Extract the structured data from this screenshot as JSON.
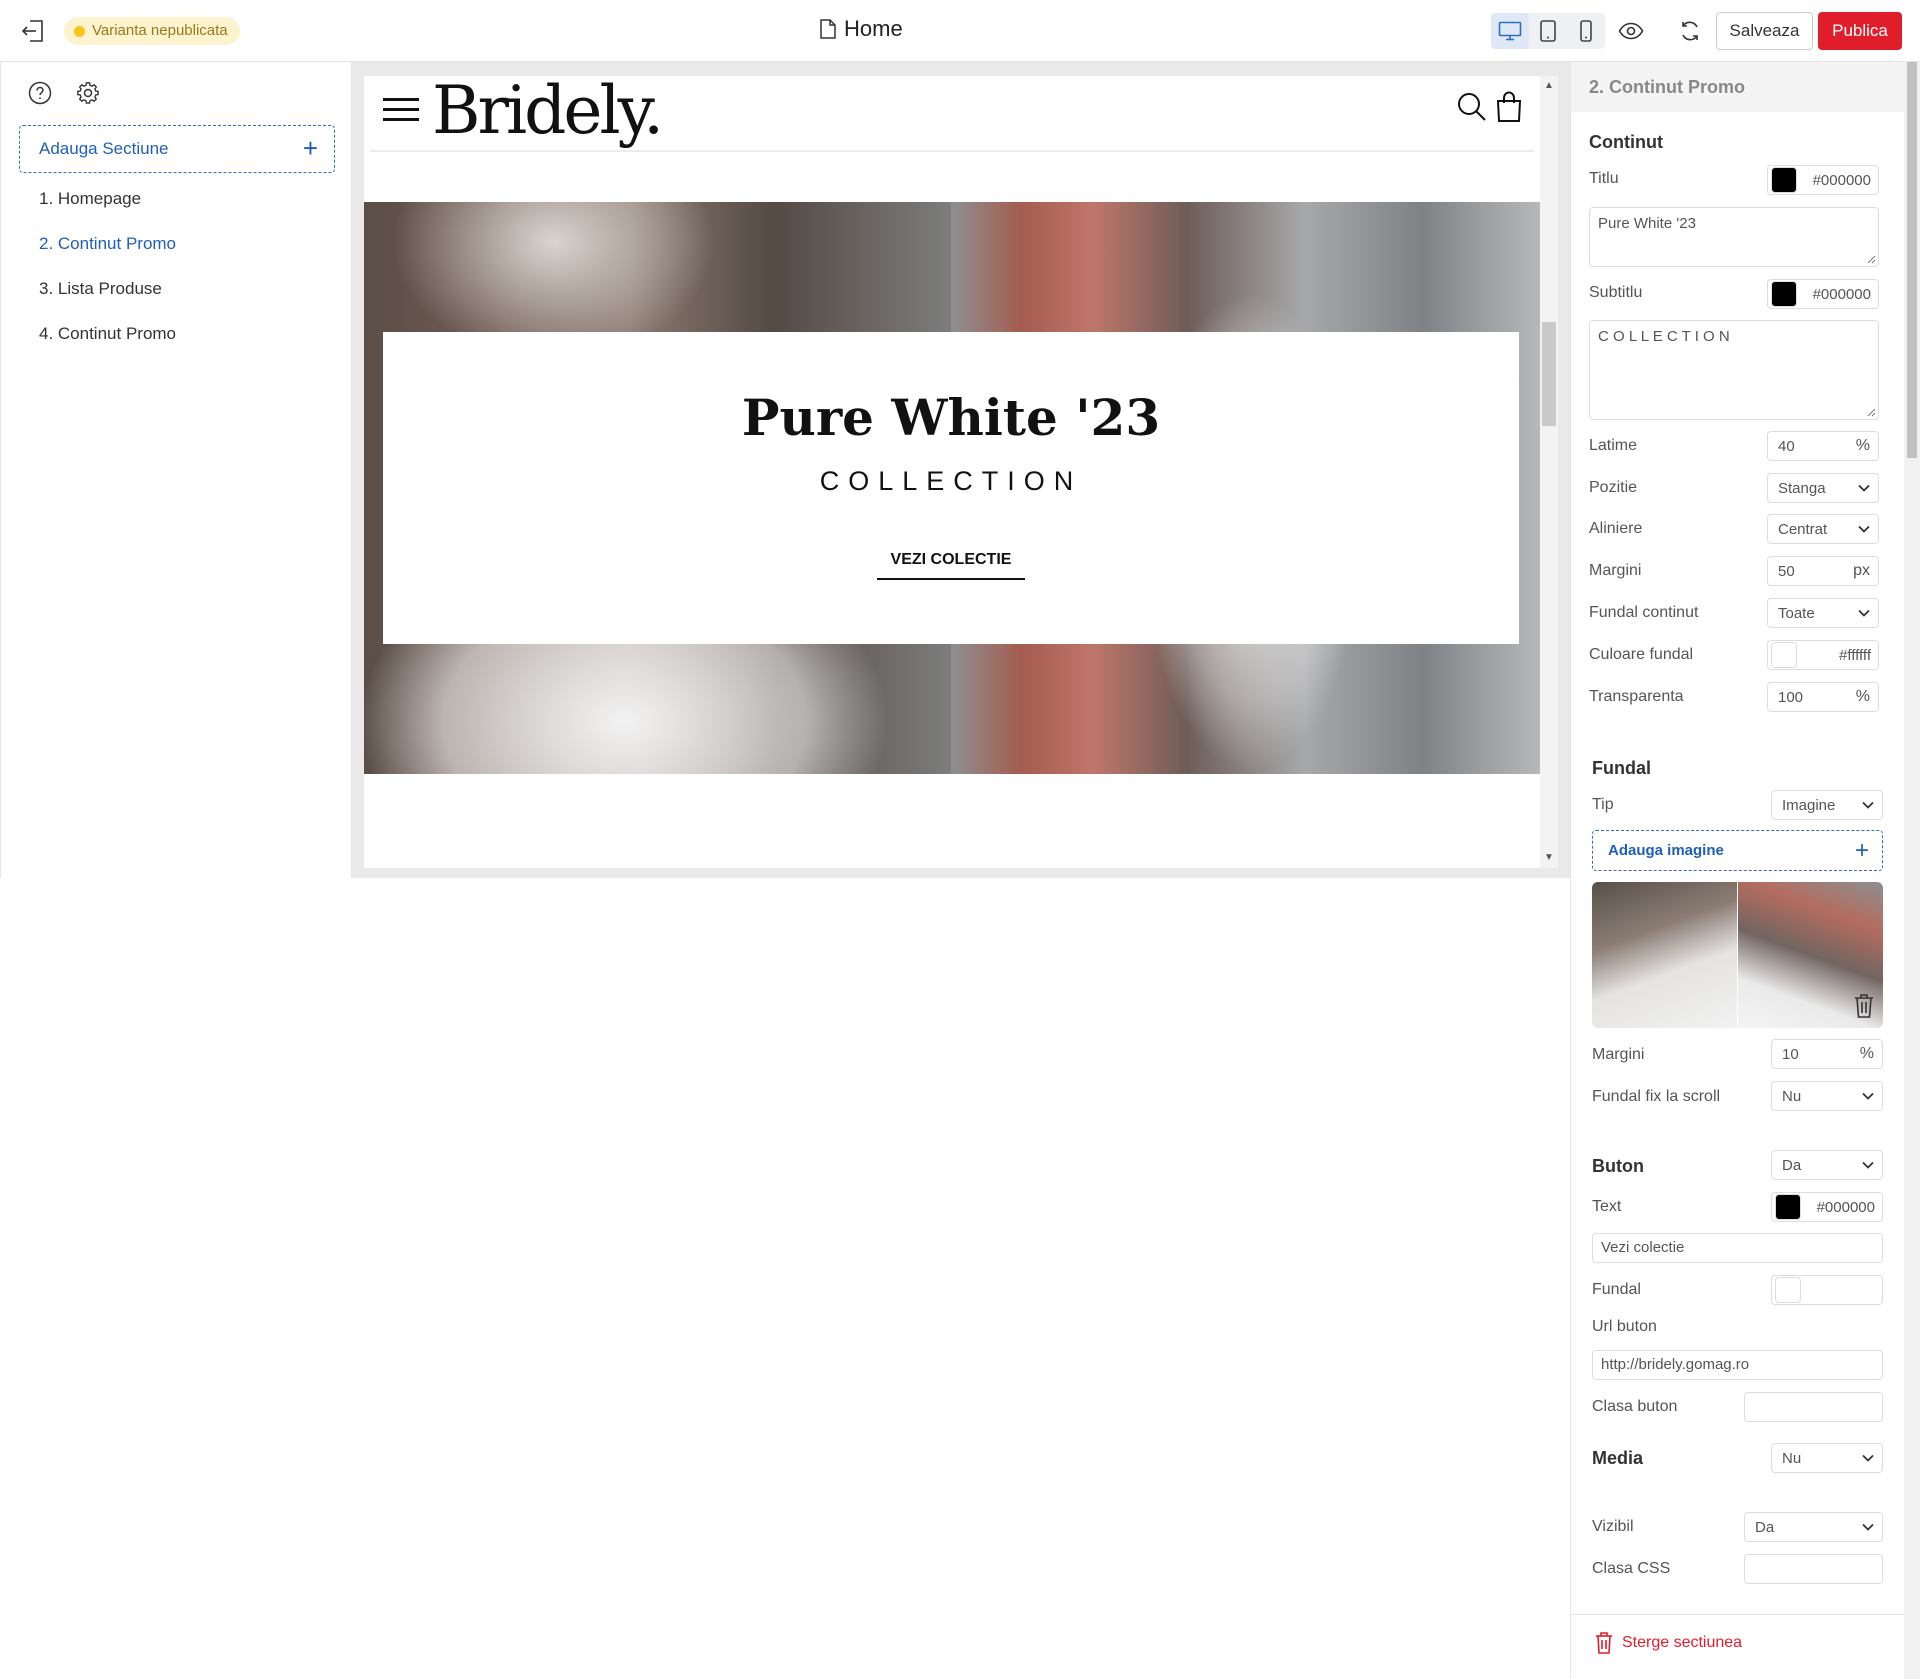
{
  "topbar": {
    "status": "Varianta nepublicata",
    "page_title": "Home",
    "save_label": "Salveaza",
    "publish_label": "Publica"
  },
  "sidebar": {
    "add_section_label": "Adauga Sectiune",
    "add_icon": "+",
    "items": [
      {
        "label": "1. Homepage"
      },
      {
        "label": "2. Continut Promo"
      },
      {
        "label": "3. Lista Produse"
      },
      {
        "label": "4. Continut Promo"
      }
    ]
  },
  "site": {
    "logo": "Bridely.",
    "promo_title": "Pure White '23",
    "promo_subtitle": "COLLECTION",
    "promo_button": "VEZI COLECTIE"
  },
  "panel": {
    "header": "2. Continut Promo",
    "content": {
      "heading": "Continut",
      "title_label": "Titlu",
      "title_color": "#000000",
      "title_value": "Pure White '23",
      "subtitle_label": "Subtitlu",
      "subtitle_color": "#000000",
      "subtitle_value": "C O L L E C T I O N",
      "width_label": "Latime",
      "width_value": "40",
      "width_unit": "%",
      "position_label": "Pozitie",
      "position_value": "Stanga",
      "align_label": "Aliniere",
      "align_value": "Centrat",
      "margins_label": "Margini",
      "margins_value": "50",
      "margins_unit": "px",
      "content_bg_label": "Fundal continut",
      "content_bg_value": "Toate",
      "bg_color_label": "Culoare fundal",
      "bg_color_value": "#ffffff",
      "transparency_label": "Transparenta",
      "transparency_value": "100",
      "transparency_unit": "%"
    },
    "background": {
      "heading": "Fundal",
      "type_label": "Tip",
      "type_value": "Imagine",
      "add_image_label": "Adauga imagine",
      "margins_label": "Margini",
      "margins_value": "10",
      "margins_unit": "%",
      "fixed_label": "Fundal fix la scroll",
      "fixed_value": "Nu"
    },
    "button": {
      "heading": "Buton",
      "enabled_value": "Da",
      "text_label": "Text",
      "text_color": "#000000",
      "text_value": "Vezi colectie",
      "bg_label": "Fundal",
      "url_label": "Url buton",
      "url_value": "http://bridely.gomag.ro",
      "class_label": "Clasa buton"
    },
    "media": {
      "heading": "Media",
      "value": "Nu"
    },
    "visible_label": "Vizibil",
    "visible_value": "Da",
    "css_class_label": "Clasa CSS",
    "delete_label": "Sterge sectiunea"
  },
  "colors": {
    "accent": "#1f5fb8",
    "publish": "#e01e2b",
    "badge_bg": "#fdf3cf"
  }
}
